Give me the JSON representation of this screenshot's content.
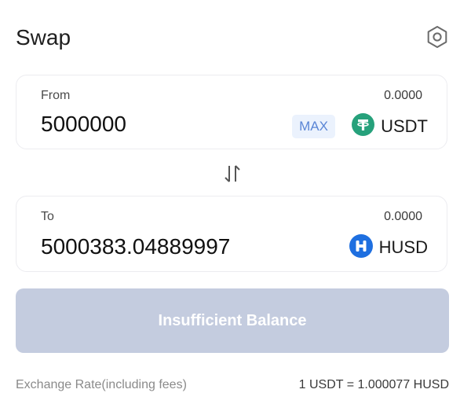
{
  "header": {
    "title": "Swap",
    "settings_icon": "gear-icon"
  },
  "from": {
    "label": "From",
    "balance": "0.0000",
    "amount": "5000000",
    "max_label": "MAX",
    "token": {
      "symbol": "USDT",
      "icon": "usdt-token-icon",
      "color": "#26a17b"
    }
  },
  "switch_icon": "swap-arrows-icon",
  "to": {
    "label": "To",
    "balance": "0.0000",
    "amount": "5000383.04889997",
    "token": {
      "symbol": "HUSD",
      "icon": "husd-token-icon",
      "color": "#1e6fe0"
    }
  },
  "submit": {
    "label": "Insufficient Balance",
    "color": "#c4ccdf"
  },
  "rate": {
    "label": "Exchange Rate(including fees)",
    "value": "1 USDT = 1.000077 HUSD"
  }
}
